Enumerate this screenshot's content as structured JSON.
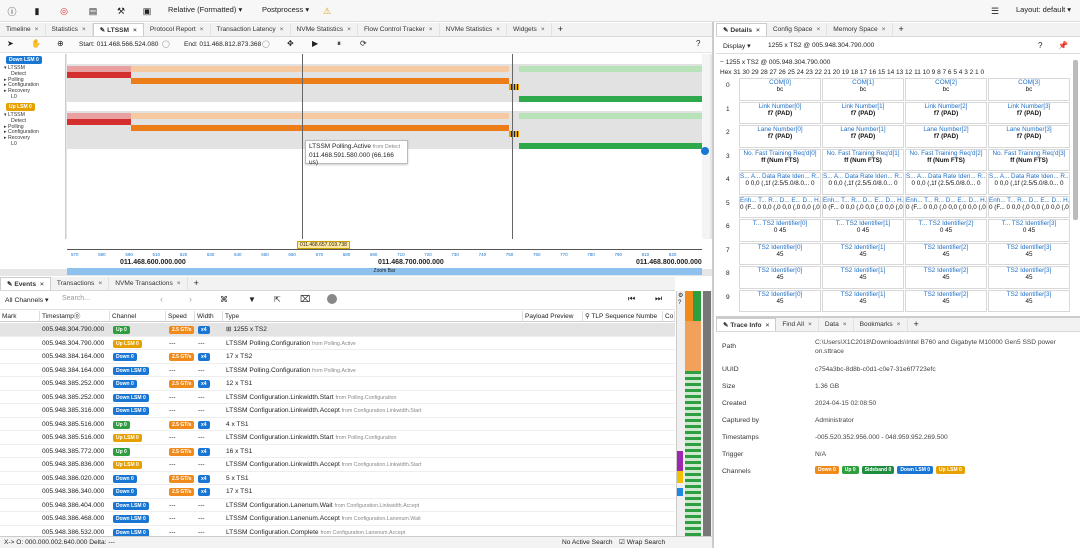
{
  "toolbar": {
    "view_mode": "Relative (Formatted)",
    "postprocess": "Postprocess",
    "layout": "Layout: default"
  },
  "top_tabs": [
    {
      "label": "Timeline",
      "close": "×"
    },
    {
      "label": "Statistics",
      "close": "×"
    },
    {
      "label": "LTSSM",
      "close": "×",
      "active": true
    },
    {
      "label": "Protocol Report",
      "close": "×"
    },
    {
      "label": "Transaction Latency",
      "close": "×"
    },
    {
      "label": "NVMe Statistics",
      "close": "×"
    },
    {
      "label": "Flow Control Tracker",
      "close": "×"
    },
    {
      "label": "NVMe Statistics",
      "close": "×"
    },
    {
      "label": "Widgets",
      "close": "×"
    }
  ],
  "plus": "+",
  "ltssm": {
    "start_label": "Start: 011.468.566.524.080",
    "end_label": "End: 011.468.812.873.368",
    "down_lsm": "Down LSM 0",
    "up_lsm": "Up LSM 0",
    "states": [
      "LTSSM",
      "Detect",
      "Polling",
      "Configuration",
      "Recovery",
      "L0"
    ],
    "tooltip_title": "LTSSM Polling.Active",
    "tooltip_from": "from Detect",
    "tooltip_time": "011.468.591.580.000 (66.166 us)",
    "cursor_time": "011.468.657.019.738",
    "ruler_major": [
      "011.468.600.000.000",
      "011.468.700.000.000",
      "011.468.800.000.000"
    ],
    "ruler_minor": [
      "570",
      "580",
      "590",
      "610",
      "620",
      "630",
      "640",
      "650",
      "660",
      "670",
      "680",
      "690",
      "710",
      "720",
      "730",
      "740",
      "750",
      "760",
      "770",
      "780",
      "790",
      "810",
      "820"
    ],
    "zoom_bar": "Zoom Bar"
  },
  "bottom_tabs": [
    {
      "label": "Events",
      "close": "×",
      "active": true
    },
    {
      "label": "Transactions",
      "close": "×"
    },
    {
      "label": "NVMe Transactions",
      "close": "×"
    }
  ],
  "events": {
    "channels": "All Channels",
    "search_placeholder": "Search...",
    "columns": [
      "Mark",
      "Timestamp",
      "Channel",
      "Speed",
      "Width",
      "Type",
      "Payload Preview",
      "TLP Sequence Numbe",
      "Co"
    ],
    "rows": [
      {
        "ts": "005.948.304.790.000",
        "ch": "Up 0",
        "chc": "b-up",
        "sp": "2.5 GT/s",
        "w": "x4",
        "type": "⊞ 1255 x TS2",
        "from": "",
        "sel": true
      },
      {
        "ts": "005.948.304.790.000",
        "ch": "Up LSM 0",
        "chc": "b-uplsm",
        "sp": "---",
        "w": "---",
        "type": "LTSSM Polling.Configuration",
        "from": "from Polling.Active"
      },
      {
        "ts": "005.948.384.164.000",
        "ch": "Down 0",
        "chc": "b-down",
        "sp": "2.5 GT/s",
        "w": "x4",
        "type": "17 x TS2",
        "from": ""
      },
      {
        "ts": "005.948.384.164.000",
        "ch": "Down LSM 0",
        "chc": "b-down",
        "sp": "---",
        "w": "---",
        "type": "LTSSM Polling.Configuration",
        "from": "from Polling.Active"
      },
      {
        "ts": "005.948.385.252.000",
        "ch": "Down 0",
        "chc": "b-down",
        "sp": "2.5 GT/s",
        "w": "x4",
        "type": "12 x TS1",
        "from": ""
      },
      {
        "ts": "005.948.385.252.000",
        "ch": "Down LSM 0",
        "chc": "b-down",
        "sp": "---",
        "w": "---",
        "type": "LTSSM Configuration.Linkwidth.Start",
        "from": "from Polling.Configuration"
      },
      {
        "ts": "005.948.385.316.000",
        "ch": "Down LSM 0",
        "chc": "b-down",
        "sp": "---",
        "w": "---",
        "type": "LTSSM Configuration.Linkwidth.Accept",
        "from": "from Configuration.Linkwidth.Start"
      },
      {
        "ts": "005.948.385.516.000",
        "ch": "Up 0",
        "chc": "b-up",
        "sp": "2.5 GT/s",
        "w": "x4",
        "type": "4 x TS1",
        "from": ""
      },
      {
        "ts": "005.948.385.516.000",
        "ch": "Up LSM 0",
        "chc": "b-uplsm",
        "sp": "---",
        "w": "---",
        "type": "LTSSM Configuration.Linkwidth.Start",
        "from": "from Polling.Configuration"
      },
      {
        "ts": "005.948.385.772.000",
        "ch": "Up 0",
        "chc": "b-up",
        "sp": "2.5 GT/s",
        "w": "x4",
        "type": "16 x TS1",
        "from": ""
      },
      {
        "ts": "005.948.385.836.000",
        "ch": "Up LSM 0",
        "chc": "b-uplsm",
        "sp": "---",
        "w": "---",
        "type": "LTSSM Configuration.Linkwidth.Accept",
        "from": "from Configuration.Linkwidth.Start"
      },
      {
        "ts": "005.948.386.020.000",
        "ch": "Down 0",
        "chc": "b-down",
        "sp": "2.5 GT/s",
        "w": "x4",
        "type": "5 x TS1",
        "from": ""
      },
      {
        "ts": "005.948.386.340.000",
        "ch": "Down 0",
        "chc": "b-down",
        "sp": "2.5 GT/s",
        "w": "x4",
        "type": "17 x TS1",
        "from": ""
      },
      {
        "ts": "005.948.386.404.000",
        "ch": "Down LSM 0",
        "chc": "b-down",
        "sp": "---",
        "w": "---",
        "type": "LTSSM Configuration.Lanenum.Wait",
        "from": "from Configuration.Linkwidth.Accept"
      },
      {
        "ts": "005.948.386.468.000",
        "ch": "Down LSM 0",
        "chc": "b-down",
        "sp": "---",
        "w": "---",
        "type": "LTSSM Configuration.Lanenum.Accept",
        "from": "from Configuration.Lanenum.Wait"
      },
      {
        "ts": "005.948.386.532.000",
        "ch": "Down LSM 0",
        "chc": "b-down",
        "sp": "---",
        "w": "---",
        "type": "LTSSM Configuration.Complete",
        "from": "from Configuration.Lanenum.Accept"
      }
    ]
  },
  "status": {
    "delta": "X-> O: 000.000.002.640.000   Delta: ---",
    "no_active_search": "No Active Search",
    "wrap_search": "Wrap Search"
  },
  "details": {
    "tabs": [
      {
        "label": "Details",
        "close": "×",
        "active": true
      },
      {
        "label": "Config Space",
        "close": "×"
      },
      {
        "label": "Memory Space",
        "close": "×"
      }
    ],
    "display": "Display",
    "header": "1255 x TS2 @ 005.948.304.790.000",
    "tree_title": "− 1255 x TS2 @ 005.948.304.790.000",
    "hex_header": "Hex 31 30 29 28 27 26 25 24 23 22 21 20 19 18 17 16 15 14 13 12 11 10 9 8 7 6 5 4 3 2 1 0",
    "rows": [
      {
        "idx": "0",
        "cells": [
          {
            "n": "COM[0]",
            "v": "bc"
          },
          {
            "n": "COM[1]",
            "v": "bc"
          },
          {
            "n": "COM[2]",
            "v": "bc"
          },
          {
            "n": "COM[3]",
            "v": "bc"
          }
        ]
      },
      {
        "idx": "1",
        "cells": [
          {
            "n": "Link Number[0]",
            "v": "f7 (PAD)"
          },
          {
            "n": "Link Number[1]",
            "v": "f7 (PAD)"
          },
          {
            "n": "Link Number[2]",
            "v": "f7 (PAD)"
          },
          {
            "n": "Link Number[3]",
            "v": "f7 (PAD)"
          }
        ]
      },
      {
        "idx": "2",
        "cells": [
          {
            "n": "Lane Number[0]",
            "v": "f7 (PAD)"
          },
          {
            "n": "Lane Number[1]",
            "v": "f7 (PAD)"
          },
          {
            "n": "Lane Number[2]",
            "v": "f7 (PAD)"
          },
          {
            "n": "Lane Number[3]",
            "v": "f7 (PAD)"
          }
        ]
      },
      {
        "idx": "3",
        "cells": [
          {
            "n": "No. Fast Training Req'd[0]",
            "v": "ff (Num FTS)"
          },
          {
            "n": "No. Fast Training Req'd[1]",
            "v": "ff (Num FTS)"
          },
          {
            "n": "No. Fast Training Req'd[2]",
            "v": "ff (Num FTS)"
          },
          {
            "n": "No. Fast Training Req'd[3]",
            "v": "ff (Num FTS)"
          }
        ]
      },
      {
        "idx": "4",
        "cells": [
          {
            "n": "S... A... Data Rate Iden... R...",
            "v": "0 0,0 (,1f (2.5/5.0/8.0... 0"
          },
          {
            "n": "S... A... Data Rate Iden... R...",
            "v": "0 0,0 (,1f (2.5/5.0/8.0... 0"
          },
          {
            "n": "S... A... Data Rate Iden... R...",
            "v": "0 0,0 (,1f (2.5/5.0/8.0... 0"
          },
          {
            "n": "S... A... Data Rate Iden... R...",
            "v": "0 0,0 (,1f (2.5/5.0/8.0... 0"
          }
        ]
      },
      {
        "idx": "5",
        "cells": [
          {
            "n": "Enh... T... R... D... E... D... H...",
            "v": "0 (F... 0 0,0 (,0 0,0 (,0 0,0 (,0 0"
          },
          {
            "n": "Enh... T... R... D... E... D... H...",
            "v": "0 (F... 0 0,0 (,0 0,0 (,0 0,0 (,0 0"
          },
          {
            "n": "Enh... T... R... D... E... D... H...",
            "v": "0 (F... 0 0,0 (,0 0,0 (,0 0,0 (,0 0"
          },
          {
            "n": "Enh... T... R... D... E... D... H...",
            "v": "0 (F... 0 0,0 (,0 0,0 (,0 0,0 (,0 0"
          }
        ]
      },
      {
        "idx": "6",
        "cells": [
          {
            "n": "T... TS2 Identifier[0]",
            "v": "0     45"
          },
          {
            "n": "T... TS2 Identifier[1]",
            "v": "0     45"
          },
          {
            "n": "T... TS2 Identifier[2]",
            "v": "0     45"
          },
          {
            "n": "T... TS2 Identifier[3]",
            "v": "0     45"
          }
        ]
      },
      {
        "idx": "7",
        "cells": [
          {
            "n": "TS2 Identifier[0]",
            "v": "45"
          },
          {
            "n": "TS2 Identifier[1]",
            "v": "45"
          },
          {
            "n": "TS2 Identifier[2]",
            "v": "45"
          },
          {
            "n": "TS2 Identifier[3]",
            "v": "45"
          }
        ]
      },
      {
        "idx": "8",
        "cells": [
          {
            "n": "TS2 Identifier[0]",
            "v": "45"
          },
          {
            "n": "TS2 Identifier[1]",
            "v": "45"
          },
          {
            "n": "TS2 Identifier[2]",
            "v": "45"
          },
          {
            "n": "TS2 Identifier[3]",
            "v": "45"
          }
        ]
      },
      {
        "idx": "9",
        "cells": [
          {
            "n": "TS2 Identifier[0]",
            "v": "45"
          },
          {
            "n": "TS2 Identifier[1]",
            "v": "45"
          },
          {
            "n": "TS2 Identifier[2]",
            "v": "45"
          },
          {
            "n": "TS2 Identifier[3]",
            "v": "45"
          }
        ]
      }
    ]
  },
  "trace_tabs": [
    {
      "label": "Trace Info",
      "close": "×",
      "active": true
    },
    {
      "label": "Find All",
      "close": "×"
    },
    {
      "label": "Data",
      "close": "×"
    },
    {
      "label": "Bookmarks",
      "close": "×"
    }
  ],
  "trace_info": {
    "path_label": "Path",
    "path": "C:\\Users\\X1C2018\\Downloads\\Intel B760 and Gigabyte M10000 Gen5 SSD power on.sttrace",
    "uuid_label": "UUID",
    "uuid": "c754a3bc-8d8b-c0d1-c0e7-31e6f7723efc",
    "size_label": "Size",
    "size": "1.36 GB",
    "created_label": "Created",
    "created": "2024-04-15 02:08:50",
    "captured_label": "Captured by",
    "captured": "Administrator",
    "timestamps_label": "Timestamps",
    "timestamps": "-005.520.352.956.000 - 048.959.952.269.500",
    "trigger_label": "Trigger",
    "trigger": "N/A",
    "channels_label": "Channels",
    "channels": [
      {
        "label": "Down 0",
        "cls": "b-sp"
      },
      {
        "label": "Up 0",
        "cls": "b-up"
      },
      {
        "label": "Sideband 0",
        "cls": "b-side"
      },
      {
        "label": "Down LSM 0",
        "cls": "b-down"
      },
      {
        "label": "Up LSM 0",
        "cls": "b-uplsm"
      }
    ]
  }
}
